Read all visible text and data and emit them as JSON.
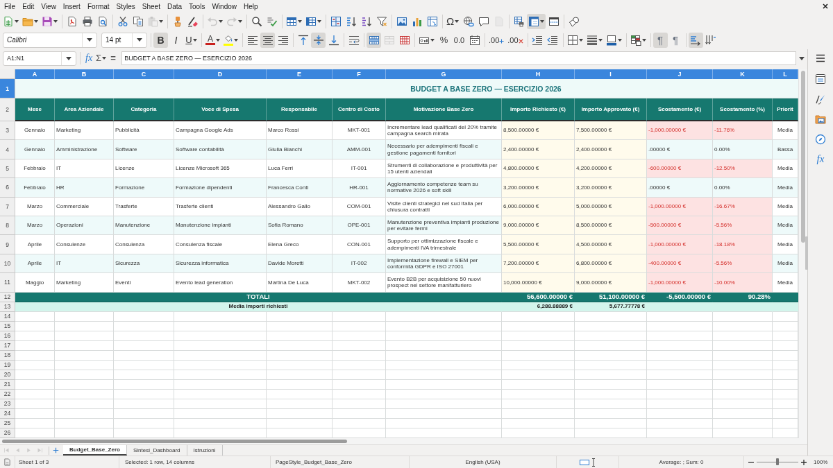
{
  "menu": [
    "File",
    "Edit",
    "View",
    "Insert",
    "Format",
    "Styles",
    "Sheet",
    "Data",
    "Tools",
    "Window",
    "Help"
  ],
  "toolbar_standard": [
    [
      {
        "kind": "new",
        "dropdown": true,
        "pressed": false,
        "disabled": false
      },
      {
        "kind": "open",
        "dropdown": true,
        "pressed": false,
        "disabled": false
      },
      {
        "kind": "save",
        "dropdown": true,
        "pressed": false,
        "disabled": false
      }
    ],
    [
      {
        "kind": "pdf",
        "dropdown": false,
        "pressed": false,
        "disabled": false
      },
      {
        "kind": "print",
        "dropdown": false,
        "pressed": false,
        "disabled": false
      },
      {
        "kind": "preview",
        "dropdown": false,
        "pressed": false,
        "disabled": false
      }
    ],
    [
      {
        "kind": "cut",
        "dropdown": false,
        "pressed": false,
        "disabled": false
      },
      {
        "kind": "copy",
        "dropdown": false,
        "pressed": false,
        "disabled": false
      },
      {
        "kind": "paste",
        "dropdown": true,
        "pressed": false,
        "disabled": true
      }
    ],
    [
      {
        "kind": "clone",
        "dropdown": false,
        "pressed": false,
        "disabled": false
      },
      {
        "kind": "clear",
        "dropdown": false,
        "pressed": false,
        "disabled": false
      }
    ],
    [
      {
        "kind": "undo",
        "dropdown": true,
        "pressed": false,
        "disabled": true
      },
      {
        "kind": "redo",
        "dropdown": true,
        "pressed": false,
        "disabled": true
      }
    ],
    [
      {
        "kind": "find",
        "dropdown": false,
        "pressed": false,
        "disabled": false
      },
      {
        "kind": "spelling",
        "dropdown": false,
        "pressed": false,
        "disabled": false
      }
    ],
    [
      {
        "kind": "rows",
        "dropdown": true,
        "pressed": false,
        "disabled": false
      },
      {
        "kind": "columns",
        "dropdown": true,
        "pressed": false,
        "disabled": false
      }
    ],
    [
      {
        "kind": "sort",
        "dropdown": false,
        "pressed": false,
        "disabled": false
      },
      {
        "kind": "sort_asc",
        "dropdown": false,
        "pressed": false,
        "disabled": false
      },
      {
        "kind": "sort_desc",
        "dropdown": false,
        "pressed": false,
        "disabled": false
      },
      {
        "kind": "filter",
        "dropdown": false,
        "pressed": false,
        "disabled": false
      }
    ],
    [
      {
        "kind": "image",
        "dropdown": false,
        "pressed": false,
        "disabled": false
      },
      {
        "kind": "chart",
        "dropdown": false,
        "pressed": false,
        "disabled": false
      },
      {
        "kind": "pivot",
        "dropdown": false,
        "pressed": false,
        "disabled": false
      }
    ],
    [
      {
        "kind": "special",
        "label": "Ω",
        "dropdown": true,
        "pressed": false,
        "disabled": false
      },
      {
        "kind": "hyperlink",
        "dropdown": false,
        "pressed": false,
        "disabled": false
      },
      {
        "kind": "comment",
        "dropdown": false,
        "pressed": false,
        "disabled": false
      },
      {
        "kind": "note",
        "dropdown": false,
        "pressed": false,
        "disabled": true
      }
    ],
    [
      {
        "kind": "print_ranges",
        "dropdown": false,
        "pressed": false,
        "disabled": false
      },
      {
        "kind": "freeze",
        "dropdown": true,
        "pressed": true,
        "disabled": false
      },
      {
        "kind": "split",
        "dropdown": false,
        "pressed": false,
        "disabled": false
      }
    ],
    [
      {
        "kind": "draw",
        "dropdown": false,
        "pressed": false,
        "disabled": false
      }
    ]
  ],
  "toolbar_formatting": {
    "font_name": "Calibri",
    "font_size": "14 pt",
    "groups": [
      [
        {
          "kind": "bold",
          "label": "B",
          "dropdown": false,
          "pressed": true,
          "disabled": false
        },
        {
          "kind": "italic",
          "label": "I",
          "dropdown": false,
          "pressed": false,
          "disabled": false
        },
        {
          "kind": "underline",
          "label": "U",
          "dropdown": true,
          "pressed": false,
          "disabled": false
        }
      ],
      [
        {
          "kind": "font_color",
          "label": "A",
          "color": "#c9211e",
          "dropdown": true,
          "pressed": false,
          "disabled": false
        },
        {
          "kind": "highlight",
          "color": "#ffff00",
          "dropdown": true,
          "pressed": false,
          "disabled": false
        }
      ],
      [
        {
          "kind": "align_left",
          "dropdown": false,
          "pressed": false,
          "disabled": false
        },
        {
          "kind": "align_center",
          "dropdown": false,
          "pressed": true,
          "disabled": false
        },
        {
          "kind": "align_right",
          "dropdown": false,
          "pressed": false,
          "disabled": false
        }
      ],
      [
        {
          "kind": "align_top",
          "dropdown": false,
          "pressed": false,
          "disabled": false
        },
        {
          "kind": "align_middle",
          "dropdown": false,
          "pressed": true,
          "disabled": false
        },
        {
          "kind": "align_bottom",
          "dropdown": false,
          "pressed": false,
          "disabled": false
        }
      ],
      [
        {
          "kind": "wrap",
          "dropdown": false,
          "pressed": false,
          "disabled": false
        }
      ],
      [
        {
          "kind": "merge_center",
          "dropdown": false,
          "pressed": true,
          "disabled": false
        },
        {
          "kind": "merge",
          "dropdown": false,
          "pressed": false,
          "disabled": true
        },
        {
          "kind": "unmerge",
          "dropdown": false,
          "pressed": false,
          "disabled": false
        }
      ],
      [
        {
          "kind": "currency",
          "dropdown": true,
          "pressed": false,
          "disabled": false
        },
        {
          "kind": "percent",
          "label": "%",
          "dropdown": false,
          "pressed": false,
          "disabled": false
        },
        {
          "kind": "number",
          "label": "0.0",
          "dropdown": false,
          "pressed": false,
          "disabled": false
        },
        {
          "kind": "date",
          "dropdown": false,
          "pressed": false,
          "disabled": false
        }
      ],
      [
        {
          "kind": "add_decimal",
          "label": ".00",
          "dropdown": false,
          "pressed": false,
          "disabled": false
        },
        {
          "kind": "delete_decimal",
          "label": ".00",
          "dropdown": false,
          "pressed": false,
          "disabled": false
        }
      ],
      [
        {
          "kind": "indent_more",
          "dropdown": false,
          "pressed": false,
          "disabled": false
        },
        {
          "kind": "indent_less",
          "dropdown": false,
          "pressed": false,
          "disabled": false
        }
      ],
      [
        {
          "kind": "borders",
          "dropdown": true,
          "pressed": false,
          "disabled": false
        },
        {
          "kind": "border_style",
          "dropdown": true,
          "pressed": false,
          "disabled": false
        },
        {
          "kind": "border_color",
          "dropdown": true,
          "pressed": false,
          "disabled": false
        }
      ],
      [
        {
          "kind": "conditional",
          "dropdown": true,
          "pressed": false,
          "disabled": false
        }
      ],
      [
        {
          "kind": "ltr",
          "label": "¶",
          "dropdown": false,
          "pressed": true,
          "disabled": false
        },
        {
          "kind": "rtl",
          "label": "¶",
          "dropdown": false,
          "pressed": false,
          "disabled": false
        }
      ],
      [
        {
          "kind": "text_ltr",
          "dropdown": false,
          "pressed": true,
          "disabled": false
        },
        {
          "kind": "text_ttb",
          "dropdown": false,
          "pressed": false,
          "disabled": false
        }
      ]
    ]
  },
  "formula_bar": {
    "name_box": "A1:N1",
    "buttons": [
      {
        "kind": "function_wizard",
        "label": "fx",
        "dropdown": false
      },
      {
        "kind": "sum",
        "label": "Σ",
        "dropdown": true
      },
      {
        "kind": "formula",
        "label": "=",
        "dropdown": false
      }
    ],
    "content": "BUDGET A BASE ZERO — ESERCIZIO 2026"
  },
  "sheet": {
    "columns": [
      {
        "label": "A",
        "selected": true
      },
      {
        "label": "B",
        "selected": true
      },
      {
        "label": "C",
        "selected": true
      },
      {
        "label": "D",
        "selected": true
      },
      {
        "label": "E",
        "selected": true
      },
      {
        "label": "F",
        "selected": true
      },
      {
        "label": "G",
        "selected": true
      },
      {
        "label": "H",
        "selected": true
      },
      {
        "label": "I",
        "selected": true
      },
      {
        "label": "J",
        "selected": true
      },
      {
        "label": "K",
        "selected": true
      },
      {
        "label": "L",
        "selected": true
      }
    ],
    "title_row": {
      "number": "1",
      "selected": true,
      "title": "BUDGET A BASE ZERO — ESERCIZIO 2026"
    },
    "header_row": {
      "number": "2",
      "selected": false,
      "cells": [
        "Mese",
        "Area Aziendale",
        "Categoria",
        "Voce di Spesa",
        "Responsabile",
        "Centro di Costo",
        "Motivazione Base Zero",
        "Importo Richiesto (€)",
        "Importo Approvato (€)",
        "Scostamento (€)",
        "Scostamento (%)",
        "Priorit"
      ]
    },
    "rows": [
      {
        "number": "3",
        "selected": false,
        "variance_alert": true,
        "cells": [
          "Gennaio",
          "Marketing",
          "Pubblicità",
          "Campagna Google Ads",
          "Marco Rossi",
          "MKT-001",
          "Incrementare lead qualificati del 20% tramite campagna search mirata",
          "8,500.00000 €",
          "7,500.00000 €",
          "-1,000.00000 €",
          "-11.76%",
          "Media"
        ]
      },
      {
        "number": "4",
        "selected": false,
        "variance_alert": false,
        "cells": [
          "Gennaio",
          "Amministrazione",
          "Software",
          "Software contabilità",
          "Giulia Bianchi",
          "AMM-001",
          "Necessario per adempimenti fiscali e gestione pagamenti fornitori",
          "2,400.00000 €",
          "2,400.00000 €",
          ".00000 €",
          "0.00%",
          "Bassa"
        ]
      },
      {
        "number": "5",
        "selected": false,
        "variance_alert": true,
        "cells": [
          "Febbraio",
          "IT",
          "Licenze",
          "Licenze Microsoft 365",
          "Luca Ferri",
          "IT-001",
          "Strumenti di collaborazione e produttività per 15 utenti aziendali",
          "4,800.00000 €",
          "4,200.00000 €",
          "-600.00000 €",
          "-12.50%",
          "Media"
        ]
      },
      {
        "number": "6",
        "selected": false,
        "variance_alert": false,
        "cells": [
          "Febbraio",
          "HR",
          "Formazione",
          "Formazione dipendenti",
          "Francesca Conti",
          "HR-001",
          "Aggiornamento competenze team su normative 2026 e soft skill",
          "3,200.00000 €",
          "3,200.00000 €",
          ".00000 €",
          "0.00%",
          "Media"
        ]
      },
      {
        "number": "7",
        "selected": false,
        "variance_alert": true,
        "cells": [
          "Marzo",
          "Commerciale",
          "Trasferte",
          "Trasferte clienti",
          "Alessandro Gallo",
          "COM-001",
          "Visite clienti strategici nel sud Italia per chiusura contratti",
          "6,000.00000 €",
          "5,000.00000 €",
          "-1,000.00000 €",
          "-16.67%",
          "Media"
        ]
      },
      {
        "number": "8",
        "selected": false,
        "variance_alert": true,
        "cells": [
          "Marzo",
          "Operazioni",
          "Manutenzione",
          "Manutenzione impianti",
          "Sofia Romano",
          "OPE-001",
          "Manutenzione preventiva impianti produzione per evitare fermi",
          "9,000.00000 €",
          "8,500.00000 €",
          "-500.00000 €",
          "-5.56%",
          "Media"
        ]
      },
      {
        "number": "9",
        "selected": false,
        "variance_alert": true,
        "cells": [
          "Aprile",
          "Consulenze",
          "Consulenza",
          "Consulenza fiscale",
          "Elena Greco",
          "CON-001",
          "Supporto per ottimizzazione fiscale e adempimenti IVA trimestrale",
          "5,500.00000 €",
          "4,500.00000 €",
          "-1,000.00000 €",
          "-18.18%",
          "Media"
        ]
      },
      {
        "number": "10",
        "selected": false,
        "variance_alert": true,
        "cells": [
          "Aprile",
          "IT",
          "Sicurezza",
          "Sicurezza informatica",
          "Davide Moretti",
          "IT-002",
          "Implementazione firewall e SIEM per conformità GDPR e ISO 27001",
          "7,200.00000 €",
          "6,800.00000 €",
          "-400.00000 €",
          "-5.56%",
          "Media"
        ]
      },
      {
        "number": "11",
        "selected": false,
        "variance_alert": true,
        "cells": [
          "Maggio",
          "Marketing",
          "Eventi",
          "Evento lead generation",
          "Martina De Luca",
          "MKT-002",
          "Evento B2B per acquisizione 50 nuovi prospect nel settore manifatturiero",
          "10,000.00000 €",
          "9,000.00000 €",
          "-1,000.00000 €",
          "-10.00%",
          "Media"
        ]
      }
    ],
    "totals_row": {
      "number": "12",
      "selected": false,
      "label": "TOTALI",
      "values": [
        "56,600.00000 €",
        "51,100.00000 €",
        "-5,500.00000 €",
        "90.28%"
      ]
    },
    "average_row": {
      "number": "13",
      "selected": false,
      "label": "Media importi richiesti",
      "values": [
        "6,288.88889 €",
        "5,677.77778 €"
      ]
    },
    "empty_rows": [
      {
        "number": "14",
        "selected": false
      },
      {
        "number": "15",
        "selected": false
      },
      {
        "number": "16",
        "selected": false
      },
      {
        "number": "17",
        "selected": false
      },
      {
        "number": "18",
        "selected": false
      },
      {
        "number": "19",
        "selected": false
      },
      {
        "number": "20",
        "selected": false
      },
      {
        "number": "21",
        "selected": false
      },
      {
        "number": "22",
        "selected": false
      },
      {
        "number": "23",
        "selected": false
      },
      {
        "number": "24",
        "selected": false
      },
      {
        "number": "25",
        "selected": false
      },
      {
        "number": "26",
        "selected": false
      }
    ]
  },
  "sidebar": {
    "tabs": [
      {
        "kind": "properties"
      },
      {
        "kind": "styles"
      },
      {
        "kind": "gallery"
      },
      {
        "kind": "navigator"
      },
      {
        "kind": "functions",
        "label": "fx"
      }
    ]
  },
  "sheet_tabs": {
    "nav": [
      {
        "kind": "first",
        "disabled": true
      },
      {
        "kind": "previous",
        "disabled": true
      },
      {
        "kind": "next",
        "disabled": true
      },
      {
        "kind": "last",
        "disabled": true
      }
    ],
    "tabs": [
      {
        "label": "Budget_Base_Zero",
        "selected": true
      },
      {
        "label": "Sintesi_Dashboard",
        "selected": false
      },
      {
        "label": "Istruzioni",
        "selected": false
      }
    ]
  },
  "status_bar": {
    "sheet": "Sheet 1 of 3",
    "selection": "Selected: 1 row, 14 columns",
    "page_style": "PageStyle_Budget_Base_Zero",
    "language": "English (USA)",
    "summary": "Average: ; Sum: 0",
    "zoom": {
      "level": 0.5,
      "label": "100%"
    }
  }
}
